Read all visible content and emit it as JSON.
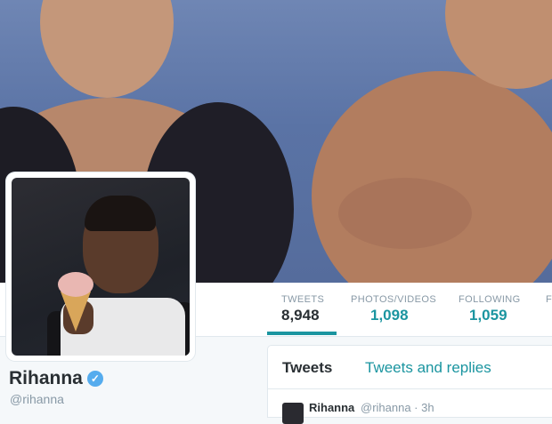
{
  "profile": {
    "name": "Rihanna",
    "handle": "@rihanna",
    "verified_icon": "verified-badge-icon"
  },
  "stats": [
    {
      "label": "TWEETS",
      "value": "8,948"
    },
    {
      "label": "PHOTOS/VIDEOS",
      "value": "1,098"
    },
    {
      "label": "FOLLOWING",
      "value": "1,059"
    },
    {
      "label": "F",
      "value": ""
    }
  ],
  "timeline": {
    "tabs": [
      "Tweets",
      "Tweets and replies"
    ],
    "first_tweet": {
      "name": "Rihanna",
      "meta": "@rihanna · 3h"
    }
  },
  "colors": {
    "accent": "#1b95a0",
    "verified": "#55acee",
    "text_primary": "#292f33",
    "text_secondary": "#8899a6"
  }
}
